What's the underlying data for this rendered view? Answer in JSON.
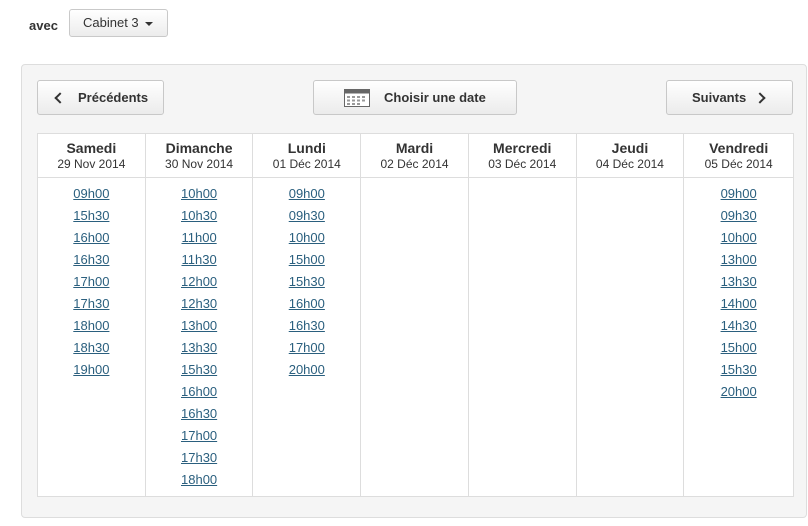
{
  "selector": {
    "label": "avec",
    "selected": "Cabinet 3"
  },
  "nav": {
    "prev_label": "Précédents",
    "date_label": "Choisir une date",
    "next_label": "Suivants"
  },
  "days": [
    {
      "name": "Samedi",
      "date": "29 Nov 2014",
      "slots": [
        "09h00",
        "15h30",
        "16h00",
        "16h30",
        "17h00",
        "17h30",
        "18h00",
        "18h30",
        "19h00"
      ]
    },
    {
      "name": "Dimanche",
      "date": "30 Nov 2014",
      "slots": [
        "10h00",
        "10h30",
        "11h00",
        "11h30",
        "12h00",
        "12h30",
        "13h00",
        "13h30",
        "15h30",
        "16h00",
        "16h30",
        "17h00",
        "17h30",
        "18h00"
      ]
    },
    {
      "name": "Lundi",
      "date": "01 Déc 2014",
      "slots": [
        "09h00",
        "09h30",
        "10h00",
        "15h00",
        "15h30",
        "16h00",
        "16h30",
        "17h00",
        "20h00"
      ]
    },
    {
      "name": "Mardi",
      "date": "02 Déc 2014",
      "slots": []
    },
    {
      "name": "Mercredi",
      "date": "03 Déc 2014",
      "slots": []
    },
    {
      "name": "Jeudi",
      "date": "04 Déc 2014",
      "slots": []
    },
    {
      "name": "Vendredi",
      "date": "05 Déc 2014",
      "slots": [
        "09h00",
        "09h30",
        "10h00",
        "13h00",
        "13h30",
        "14h00",
        "14h30",
        "15h00",
        "15h30",
        "20h00"
      ]
    }
  ],
  "colors": {
    "link": "#2a5f7e",
    "panel_bg": "#f5f5f5",
    "border": "#dddddd"
  },
  "icons": {
    "prev": "chevron-left-icon",
    "date": "calendar-icon",
    "next": "chevron-right-icon",
    "dropdown": "caret-down-icon"
  }
}
